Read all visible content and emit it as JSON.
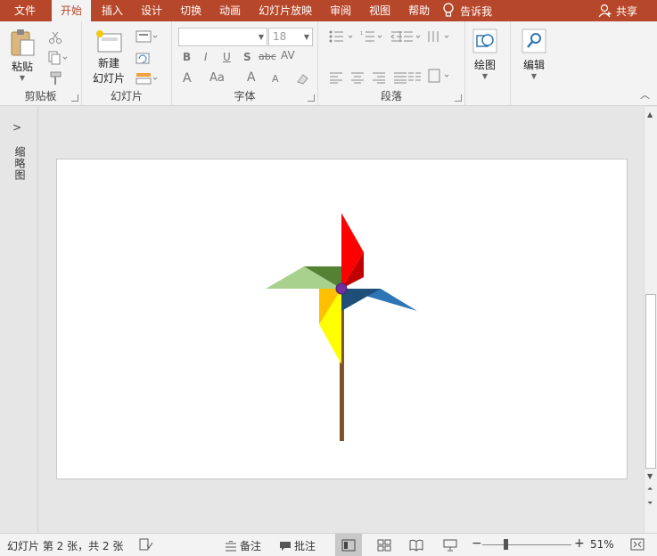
{
  "menu": {
    "tabs": [
      "文件",
      "开始",
      "插入",
      "设计",
      "切换",
      "动画",
      "幻灯片放映",
      "审阅",
      "视图",
      "帮助"
    ],
    "active_index": 1,
    "tell_me": "告诉我",
    "share": "共享"
  },
  "ribbon": {
    "clipboard": {
      "paste": "粘贴",
      "label": "剪贴板"
    },
    "slides": {
      "new_slide_line1": "新建",
      "new_slide_line2": "幻灯片",
      "label": "幻灯片"
    },
    "font": {
      "name_placeholder": "",
      "size_value": "18",
      "label": "字体",
      "bold": "B",
      "italic": "I",
      "underline": "U",
      "shadow": "S",
      "strike": "abc",
      "spacing": "AV",
      "grow": "A",
      "shrink": "A",
      "case": "Aa",
      "color": "A"
    },
    "paragraph": {
      "label": "段落"
    },
    "drawing": {
      "label": "绘图"
    },
    "editing": {
      "label": "编辑"
    }
  },
  "left_panel": {
    "expand_icon": "chevron-right-icon",
    "label": "缩略图"
  },
  "status": {
    "slide_info": "幻灯片 第 2 张，共 2 张",
    "notes": "备注",
    "comments": "批注",
    "zoom_percent": "51%",
    "zoom_level": 0.51
  },
  "colors": {
    "accent": "#b7472a",
    "blade_red": "#ff0000",
    "blade_blue": "#2e75b6",
    "blade_green": "#70ad47",
    "blade_yellow": "#ffff00",
    "pin": "#7030a0",
    "stick": "#8b5a2b"
  }
}
